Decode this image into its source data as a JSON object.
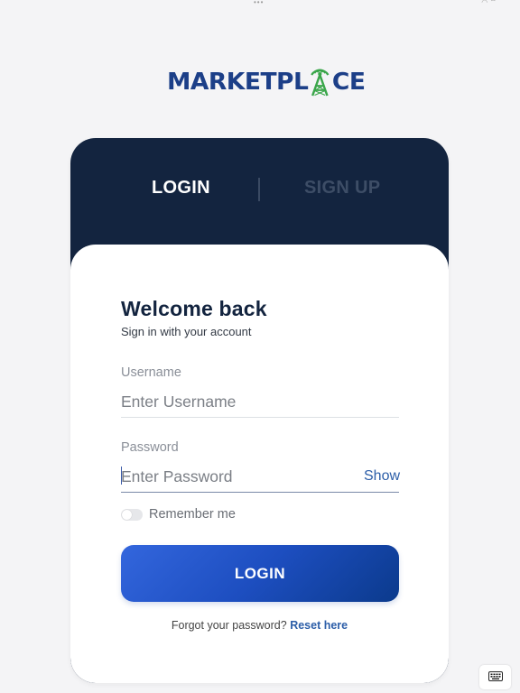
{
  "brand": {
    "logo_left": "MARKETPL",
    "logo_right": "CE",
    "logo_color": "#1c3f88",
    "tower_color": "#3aa64a"
  },
  "tabs": {
    "login": "LOGIN",
    "signup": "SIGN UP"
  },
  "form": {
    "title": "Welcome back",
    "subtitle": "Sign in with your account",
    "username_label": "Username",
    "username_placeholder": "Enter Username",
    "password_label": "Password",
    "password_placeholder": "Enter Password",
    "show_label": "Show",
    "remember_label": "Remember me",
    "login_button": "LOGIN",
    "forgot_text": "Forgot your password?",
    "reset_link": "Reset here"
  },
  "icons": {
    "keyboard": "keyboard-icon"
  },
  "colors": {
    "card_dark": "#13243f",
    "accent": "#2c5ea8",
    "button": "#1d4ec0"
  }
}
